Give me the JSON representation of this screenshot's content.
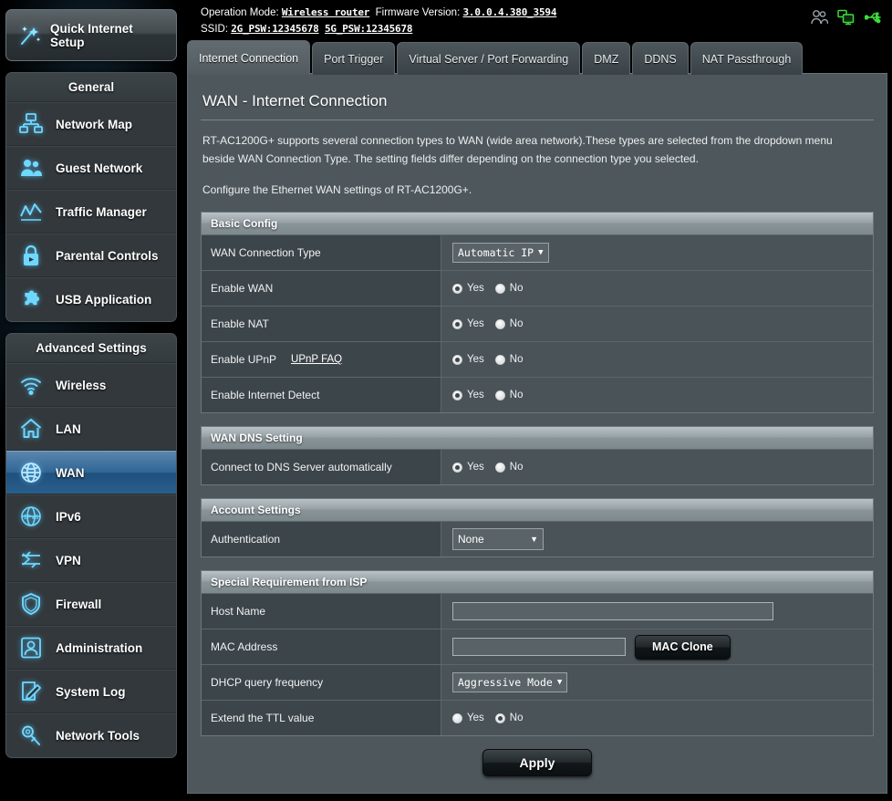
{
  "topbar": {
    "operation_mode_label": "Operation Mode:",
    "operation_mode_value": "Wireless router",
    "firmware_label": "Firmware Version:",
    "firmware_value": "3.0.0.4.380_3594",
    "ssid_label": "SSID:",
    "ssid_2g": "2G_PSW:12345678",
    "ssid_5g": "5G_PSW:12345678",
    "icons": [
      "clients-icon",
      "network-monitor-icon",
      "usb-icon"
    ]
  },
  "sidebar": {
    "quick_setup_label": "Quick Internet Setup",
    "quick_setup_icon": "magic-wand-icon",
    "general": {
      "title": "General",
      "items": [
        {
          "label": "Network Map",
          "icon": "network-map-icon"
        },
        {
          "label": "Guest Network",
          "icon": "guest-network-icon"
        },
        {
          "label": "Traffic Manager",
          "icon": "traffic-manager-icon"
        },
        {
          "label": "Parental Controls",
          "icon": "parental-controls-lock-icon"
        },
        {
          "label": "USB Application",
          "icon": "usb-application-puzzle-icon"
        }
      ]
    },
    "advanced": {
      "title": "Advanced Settings",
      "items": [
        {
          "label": "Wireless",
          "icon": "wifi-icon",
          "active": false
        },
        {
          "label": "LAN",
          "icon": "home-icon",
          "active": false
        },
        {
          "label": "WAN",
          "icon": "globe-icon",
          "active": true
        },
        {
          "label": "IPv6",
          "icon": "ipv6-globe-icon",
          "active": false
        },
        {
          "label": "VPN",
          "icon": "vpn-arrows-icon",
          "active": false
        },
        {
          "label": "Firewall",
          "icon": "shield-icon",
          "active": false
        },
        {
          "label": "Administration",
          "icon": "user-admin-icon",
          "active": false
        },
        {
          "label": "System Log",
          "icon": "log-pencil-icon",
          "active": false
        },
        {
          "label": "Network Tools",
          "icon": "wrench-icon",
          "active": false
        }
      ]
    }
  },
  "tabs": [
    {
      "label": "Internet Connection",
      "active": true
    },
    {
      "label": "Port Trigger",
      "active": false
    },
    {
      "label": "Virtual Server / Port Forwarding",
      "active": false
    },
    {
      "label": "DMZ",
      "active": false
    },
    {
      "label": "DDNS",
      "active": false
    },
    {
      "label": "NAT Passthrough",
      "active": false
    }
  ],
  "page": {
    "title": "WAN - Internet Connection",
    "desc1": "RT-AC1200G+ supports several connection types to WAN (wide area network).These types are selected from the dropdown menu beside WAN Connection Type. The setting fields differ depending on the connection type you selected.",
    "desc2": "Configure the Ethernet WAN settings of RT-AC1200G+."
  },
  "sections": {
    "basic_config": {
      "title": "Basic Config",
      "wan_connection_type": {
        "label": "WAN Connection Type",
        "value": "Automatic IP",
        "arrow": "▼"
      },
      "enable_wan": {
        "label": "Enable WAN",
        "yes": "Yes",
        "no": "No",
        "selected": "yes"
      },
      "enable_nat": {
        "label": "Enable NAT",
        "yes": "Yes",
        "no": "No",
        "selected": "yes"
      },
      "enable_upnp": {
        "label": "Enable UPnP",
        "link": "UPnP  FAQ",
        "yes": "Yes",
        "no": "No",
        "selected": "yes"
      },
      "enable_internet_detect": {
        "label": "Enable Internet Detect",
        "yes": "Yes",
        "no": "No",
        "selected": "yes"
      }
    },
    "wan_dns": {
      "title": "WAN DNS Setting",
      "connect_dns_auto": {
        "label": "Connect to DNS Server automatically",
        "yes": "Yes",
        "no": "No",
        "selected": "yes"
      }
    },
    "account_settings": {
      "title": "Account Settings",
      "authentication": {
        "label": "Authentication",
        "value": "None",
        "arrow": "▼"
      }
    },
    "special_isp": {
      "title": "Special Requirement from ISP",
      "host_name": {
        "label": "Host Name",
        "value": "",
        "placeholder": ""
      },
      "mac_address": {
        "label": "MAC Address",
        "value": "",
        "placeholder": "",
        "button": "MAC Clone"
      },
      "dhcp_query": {
        "label": "DHCP query frequency",
        "value": "Aggressive Mode",
        "arrow": "▼"
      },
      "extend_ttl": {
        "label": "Extend the TTL value",
        "yes": "Yes",
        "no": "No",
        "selected": "no"
      }
    }
  },
  "apply_label": "Apply",
  "colors": {
    "accent_cyan": "#63d2f5",
    "active_blue": "#2e6595",
    "panel_bg": "#4e585c",
    "row_bg": "#3c4549",
    "status_green": "#3ddb3d"
  }
}
